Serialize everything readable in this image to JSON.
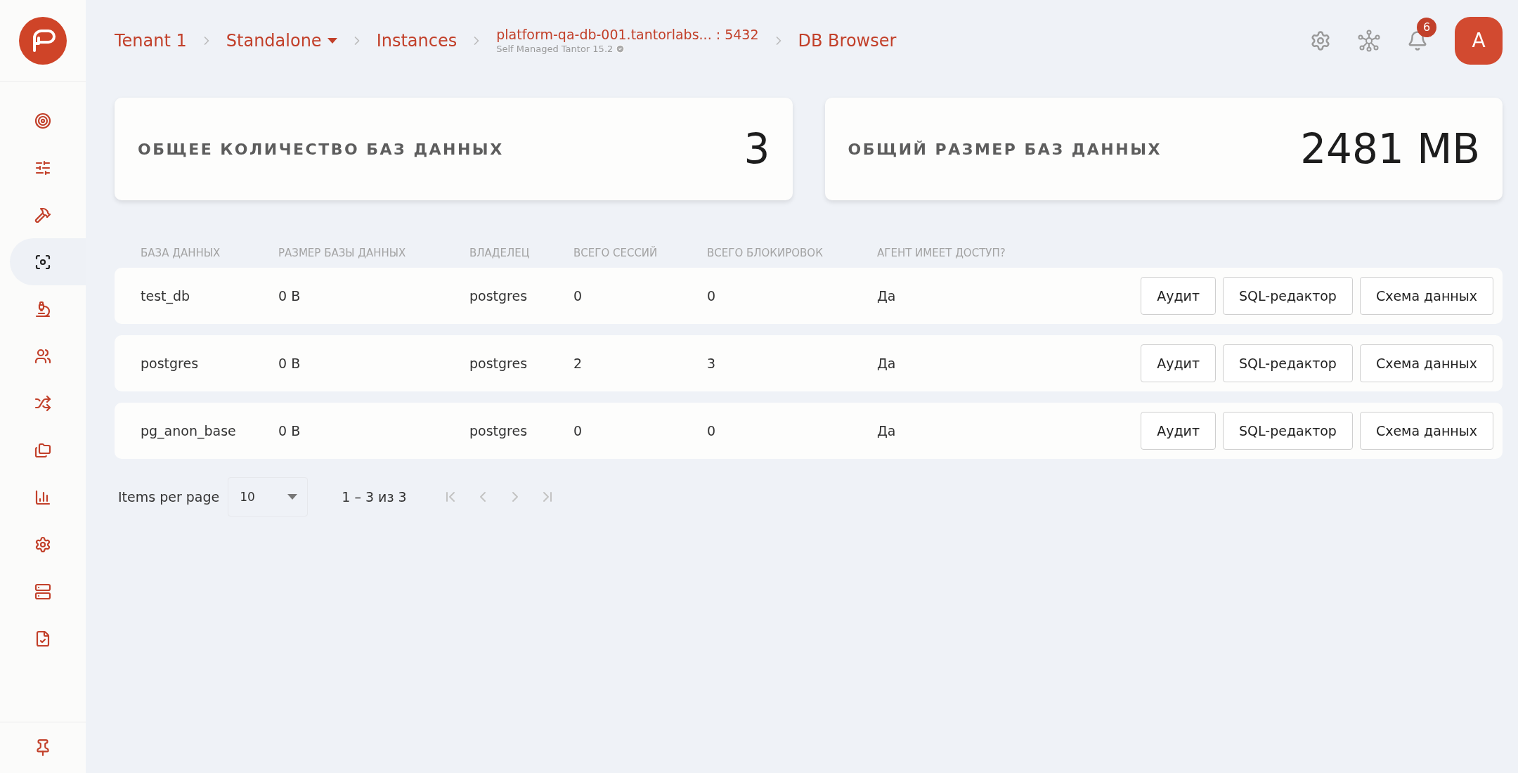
{
  "sidebar": {
    "items": [
      {
        "selected": false
      },
      {
        "selected": false
      },
      {
        "selected": false
      },
      {
        "selected": true
      },
      {
        "selected": false
      },
      {
        "selected": false
      },
      {
        "selected": false
      },
      {
        "selected": false
      },
      {
        "selected": false
      },
      {
        "selected": false
      },
      {
        "selected": false
      },
      {
        "selected": false
      }
    ]
  },
  "breadcrumbs": [
    {
      "kind": "link",
      "label": "Tenant 1"
    },
    {
      "kind": "dropdown",
      "label": "Standalone"
    },
    {
      "kind": "link",
      "label": "Instances"
    },
    {
      "kind": "instance",
      "label": "platform-qa-db-001.tantorlabs... : 5432",
      "subtitle": "Self Managed Tantor 15.2"
    },
    {
      "kind": "link",
      "label": "DB Browser"
    }
  ],
  "header": {
    "notifications": "6",
    "avatar": "A"
  },
  "stats": [
    {
      "label": "ОБЩЕЕ КОЛИЧЕСТВО БАЗ ДАННЫХ",
      "value": "3"
    },
    {
      "label": "ОБЩИЙ РАЗМЕР БАЗ ДАННЫХ",
      "value": "2481 MB"
    }
  ],
  "table": {
    "columns": [
      "БАЗА ДАННЫХ",
      "РАЗМЕР БАЗЫ ДАННЫХ",
      "ВЛАДЕЛЕЦ",
      "ВСЕГО СЕССИЙ",
      "ВСЕГО БЛОКИРОВОК",
      "АГЕНТ ИМЕЕТ ДОСТУП?"
    ],
    "rows": [
      {
        "cells": [
          "test_db",
          "0 B",
          "postgres",
          "0",
          "0",
          "Да"
        ],
        "actions": [
          "Аудит",
          "SQL-редактор",
          "Схема данных"
        ]
      },
      {
        "cells": [
          "postgres",
          "0 B",
          "postgres",
          "2",
          "3",
          "Да"
        ],
        "actions": [
          "Аудит",
          "SQL-редактор",
          "Схема данных"
        ]
      },
      {
        "cells": [
          "pg_anon_base",
          "0 B",
          "postgres",
          "0",
          "0",
          "Да"
        ],
        "actions": [
          "Аудит",
          "SQL-редактор",
          "Схема данных"
        ]
      }
    ]
  },
  "pagination": {
    "label": "Items per page",
    "page_size": "10",
    "range": "1 – 3 из 3"
  }
}
